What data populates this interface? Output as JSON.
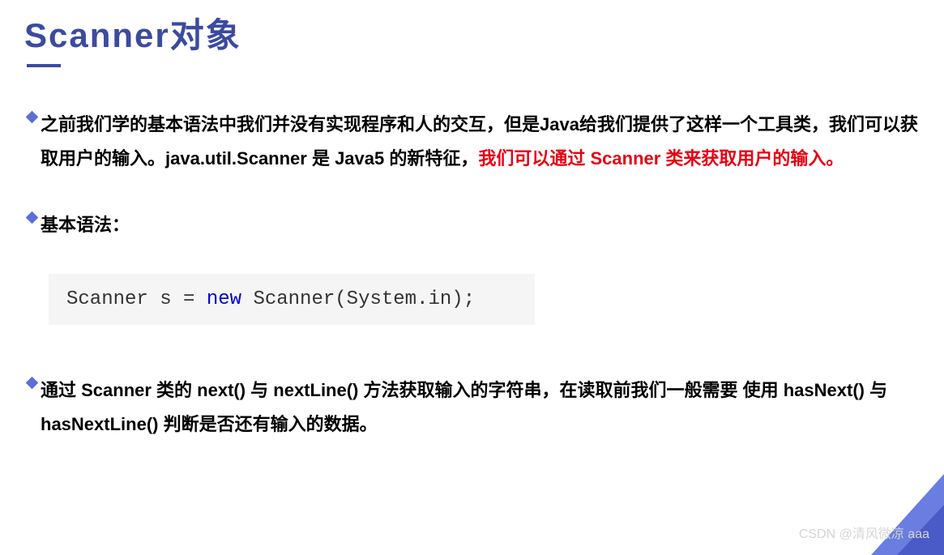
{
  "title": "Scanner对象",
  "bullets": {
    "item1_part1": "之前我们学的基本语法中我们并没有实现程序和人的交互，但是Java给我们提供了这样一个工具类，我们可以获取用户的输入。java.util.Scanner 是 Java5 的新特征，",
    "item1_highlight": "我们可以通过 Scanner 类来获取用户的输入。",
    "item2": "基本语法：",
    "item3": "通过 Scanner 类的 next() 与 nextLine() 方法获取输入的字符串，在读取前我们一般需要 使用 hasNext() 与 hasNextLine() 判断是否还有输入的数据。"
  },
  "code": {
    "part1": "Scanner s = ",
    "keyword": "new",
    "part2": " Scanner(System.in);"
  },
  "watermark": "CSDN @清风微凉 aaa"
}
